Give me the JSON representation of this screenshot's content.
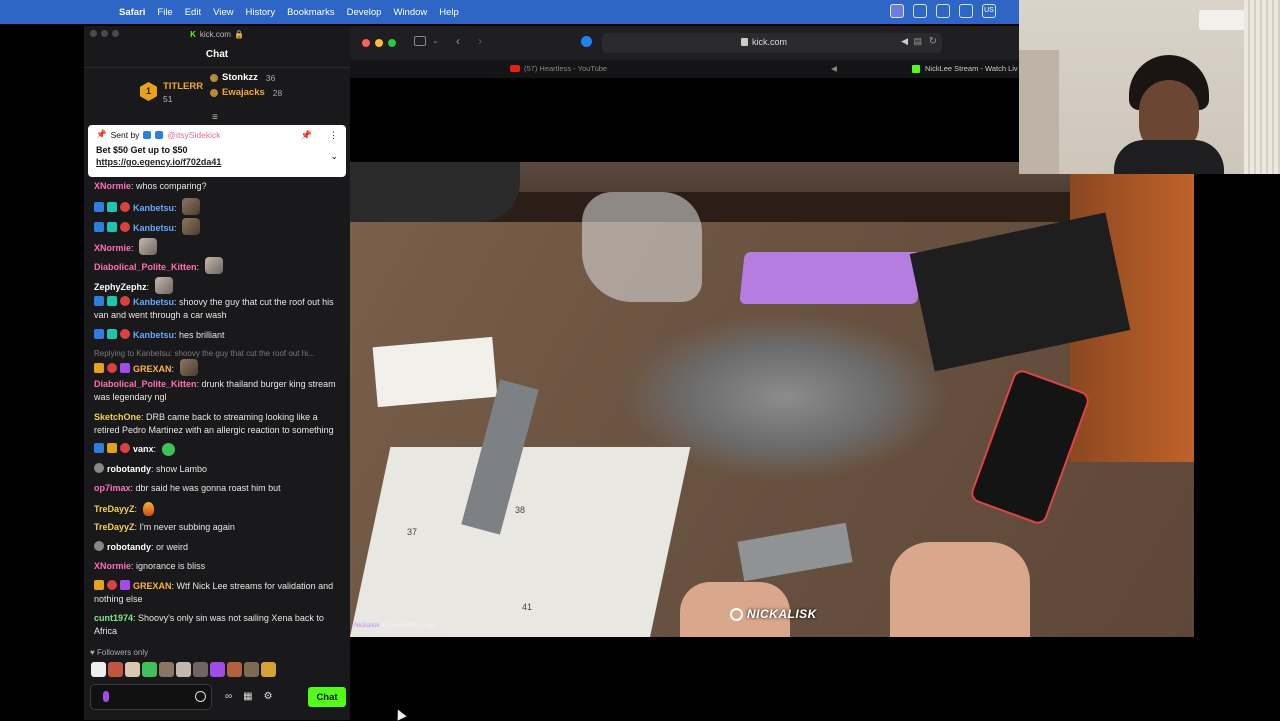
{
  "menubar": {
    "app": "Safari",
    "items": [
      "File",
      "Edit",
      "View",
      "History",
      "Bookmarks",
      "Develop",
      "Window",
      "Help"
    ],
    "tray_lang": "US"
  },
  "chat_window": {
    "url": "kick.com",
    "title": "Chat",
    "leaderboard": {
      "first": {
        "rank": "1",
        "name": "TITLERR",
        "count": "51"
      },
      "second": {
        "name": "Stonkzz",
        "count": "36"
      },
      "third": {
        "name": "Ewajacks",
        "count": "28"
      }
    },
    "pinned": {
      "sent_by": "Sent by",
      "sender": "@itsySidekick",
      "message": "Bet $50 Get up to $50",
      "link": "https://go.egency.io/f702da41"
    },
    "messages": [
      {
        "user": "XNormie",
        "text": "whos comparing?"
      },
      {
        "user": "Kanbetsu",
        "text": ""
      },
      {
        "user": "Kanbetsu",
        "text": ""
      },
      {
        "user": "XNormie",
        "text": ""
      },
      {
        "user": "Diabolical_Polite_Kitten",
        "text": ""
      },
      {
        "user": "ZephyZephz",
        "text": ""
      },
      {
        "user": "Kanbetsu",
        "text": "shoovy the guy that cut the roof out his van and went through a car wash"
      },
      {
        "user": "Kanbetsu",
        "text": "hes brilliant"
      },
      {
        "reply": "Replying to Kanbetsu: shoovy the guy that cut the roof out hi..."
      },
      {
        "user": "GREXAN",
        "text": ""
      },
      {
        "user": "Diabolical_Polite_Kitten",
        "text": "drunk thailand burger king stream was legendary ngl"
      },
      {
        "user": "SketchOne",
        "text": "DRB came back to streaming looking like a retired Pedro Martinez with an allergic reaction to something"
      },
      {
        "user": "vanx",
        "text": ""
      },
      {
        "user": "robotandy",
        "text": "show Lambo"
      },
      {
        "user": "op7imax",
        "text": "dbr said he was gonna roast him but"
      },
      {
        "user": "TreDayyZ",
        "text": ""
      },
      {
        "user": "TreDayyZ",
        "text": "I'm never subbing again"
      },
      {
        "user": "robotandy",
        "text": "or weird"
      },
      {
        "user": "XNormie",
        "text": "ignorance is bliss"
      },
      {
        "user": "GREXAN",
        "text": "Wtf Nick Lee streams for validation and nothing else"
      },
      {
        "user": "cunt1974",
        "text": "Shoovy's only sin was not sailing Xena back to Africa"
      }
    ],
    "followers_only": "Followers only",
    "send_label": "Chat"
  },
  "safari": {
    "address": "kick.com",
    "tabs": [
      {
        "title": "(57) Heartless - YouTube"
      },
      {
        "title": "NickLee Stream - Watch Liv"
      }
    ]
  },
  "video": {
    "watermark": "NICKALISK",
    "stream_title_user": "Nickalisk",
    "stream_title": "let me build a Lego",
    "page_numbers": [
      "37",
      "38",
      "41"
    ]
  }
}
